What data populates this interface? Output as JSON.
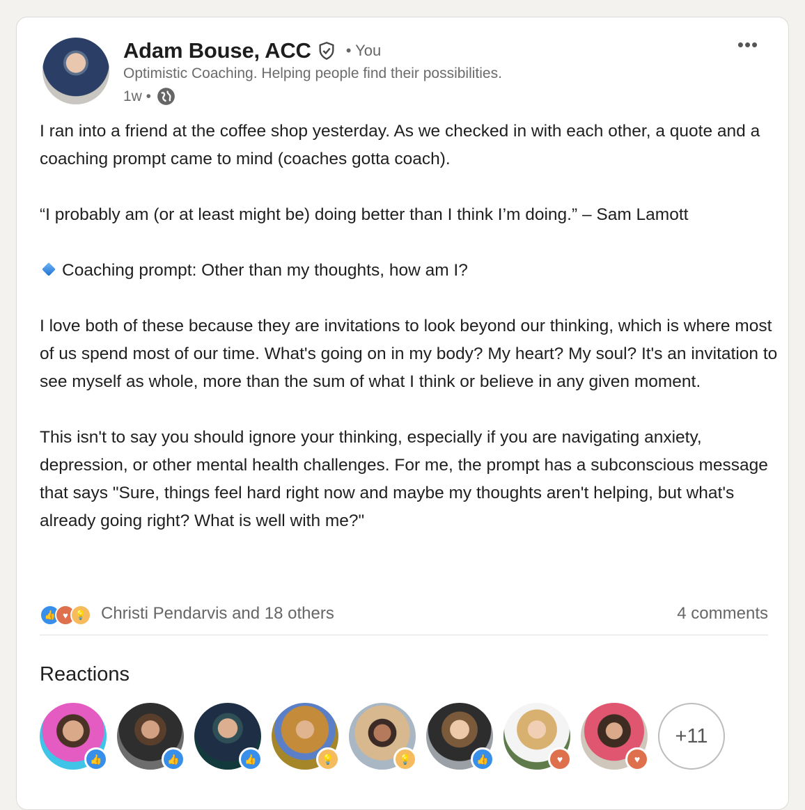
{
  "post": {
    "author": {
      "name": "Adam Bouse, ACC",
      "relation": "• You",
      "headline": "Optimistic Coaching. Helping people find their possibilities.",
      "time": "1w •",
      "verified_icon": "shield-check-icon",
      "visibility_icon": "globe-icon"
    },
    "more_label": "•••",
    "body": {
      "p1": "I ran into a friend at the coffee shop yesterday. As we checked in with each other, a quote and a coaching prompt came to mind (coaches gotta coach).",
      "p2": "“I probably am (or at least might be) doing better than I think I’m doing.” – Sam Lamott",
      "p3": "Coaching prompt: Other than my thoughts, how am I?",
      "p4": "I love both of these because they are invitations to look beyond our thinking, which is where most of us spend most of our time. What's going on in my body? My heart? My soul? It's an invitation to see myself as whole, more than the sum of what I think or believe in any given moment.",
      "p5": "This isn't to say you should ignore your thinking, especially if you are navigating anxiety, depression, or other mental health challenges. For me, the prompt has a subconscious message that says \"Sure, things feel hard right now and maybe my thoughts aren't helping, but what's already going right? What is well with me?\""
    },
    "social": {
      "reactor_names": "Christi Pendarvis and 18 others",
      "comments": "4 comments",
      "reaction_types": [
        "like",
        "love",
        "insightful"
      ]
    }
  },
  "reactions": {
    "title": "Reactions",
    "more": "+11",
    "people": [
      {
        "reaction": "like"
      },
      {
        "reaction": "like"
      },
      {
        "reaction": "like"
      },
      {
        "reaction": "insightful"
      },
      {
        "reaction": "insightful"
      },
      {
        "reaction": "like"
      },
      {
        "reaction": "love"
      },
      {
        "reaction": "love"
      }
    ]
  },
  "colors": {
    "like": "#378fe9",
    "love": "#df704d",
    "insightful": "#f5bb5c",
    "text": "#1f1f1f",
    "muted": "#666666"
  }
}
